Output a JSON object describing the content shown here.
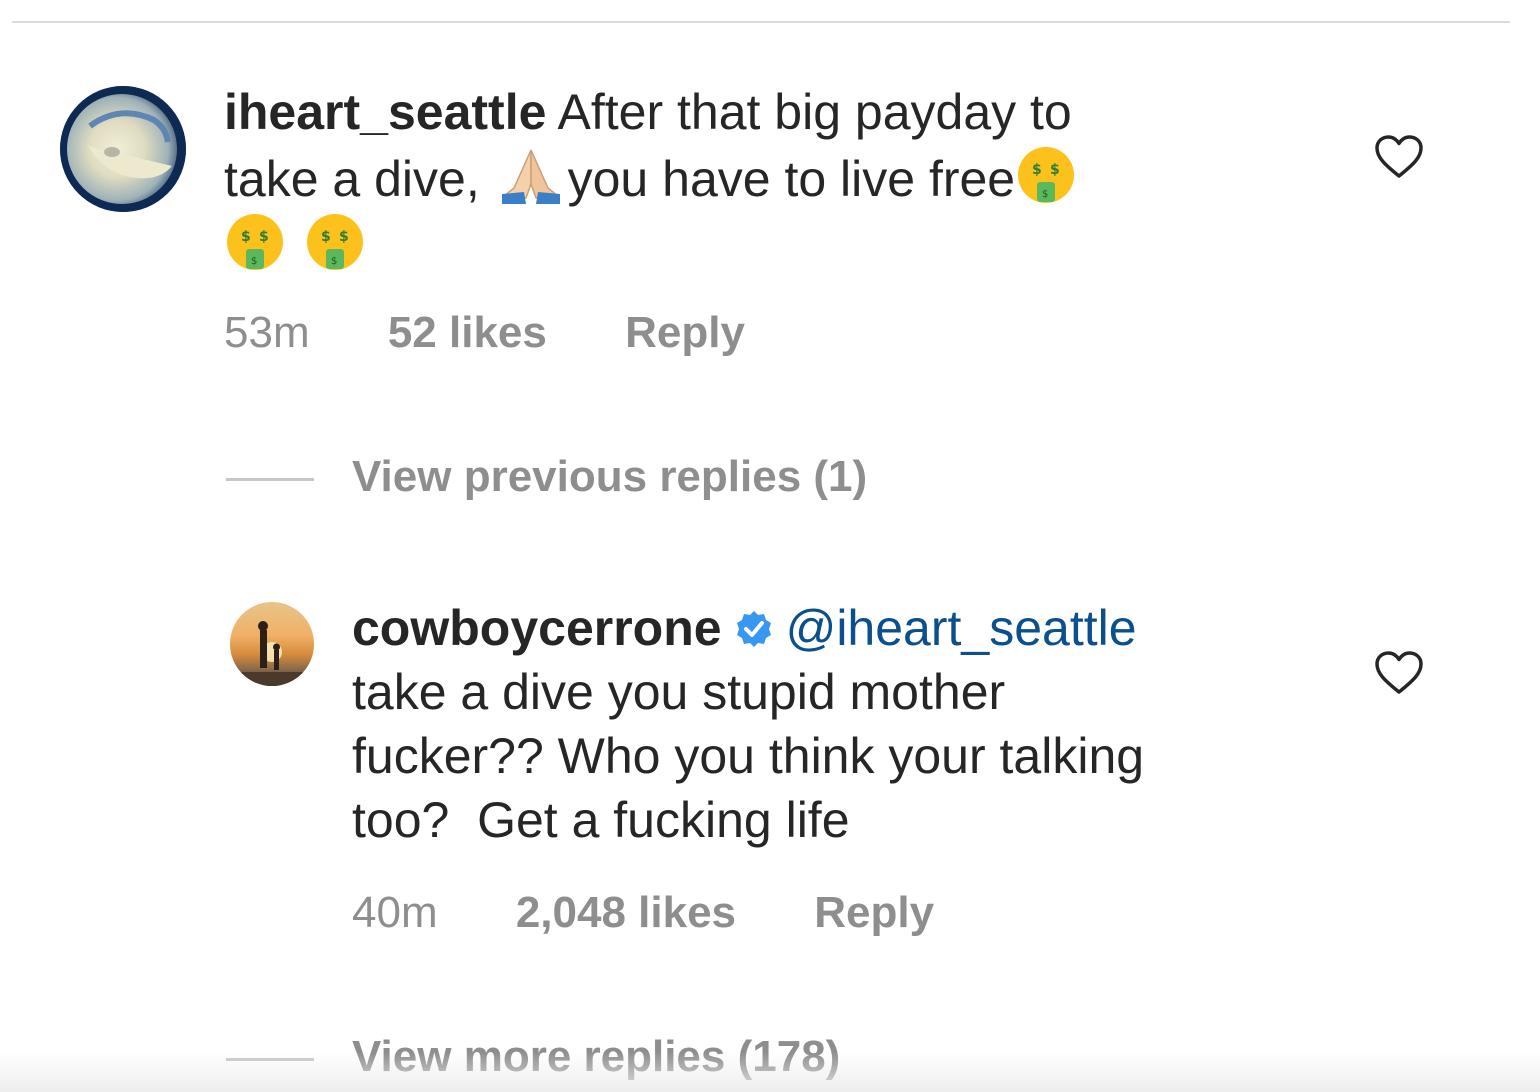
{
  "comments": [
    {
      "username": "iheart_seattle",
      "text_line1": "After that big payday to",
      "text_line2a": "take a dive,",
      "text_line2b": "you have to live free",
      "time": "53m",
      "likes": "52 likes",
      "reply_label": "Reply"
    },
    {
      "username": "cowboycerrone",
      "mention": "@iheart_seattle",
      "text_line1": "take a dive you stupid mother",
      "text_line2": "fucker?? Who you think your talking",
      "text_line3": "too?  Get a fucking life",
      "time": "40m",
      "likes": "2,048 likes",
      "reply_label": "Reply"
    }
  ],
  "view_previous_replies": "View previous replies (1)",
  "view_more_replies": "View more replies (178)",
  "icons": {
    "emoji_money": "money-mouth-face-icon",
    "emoji_pray": "folded-hands-icon",
    "verified": "verified-badge-icon",
    "like": "heart-outline-icon"
  },
  "colors": {
    "text": "#262626",
    "meta": "#8e8e8e",
    "mention": "#0b4f8c",
    "verified": "#3897f0"
  }
}
